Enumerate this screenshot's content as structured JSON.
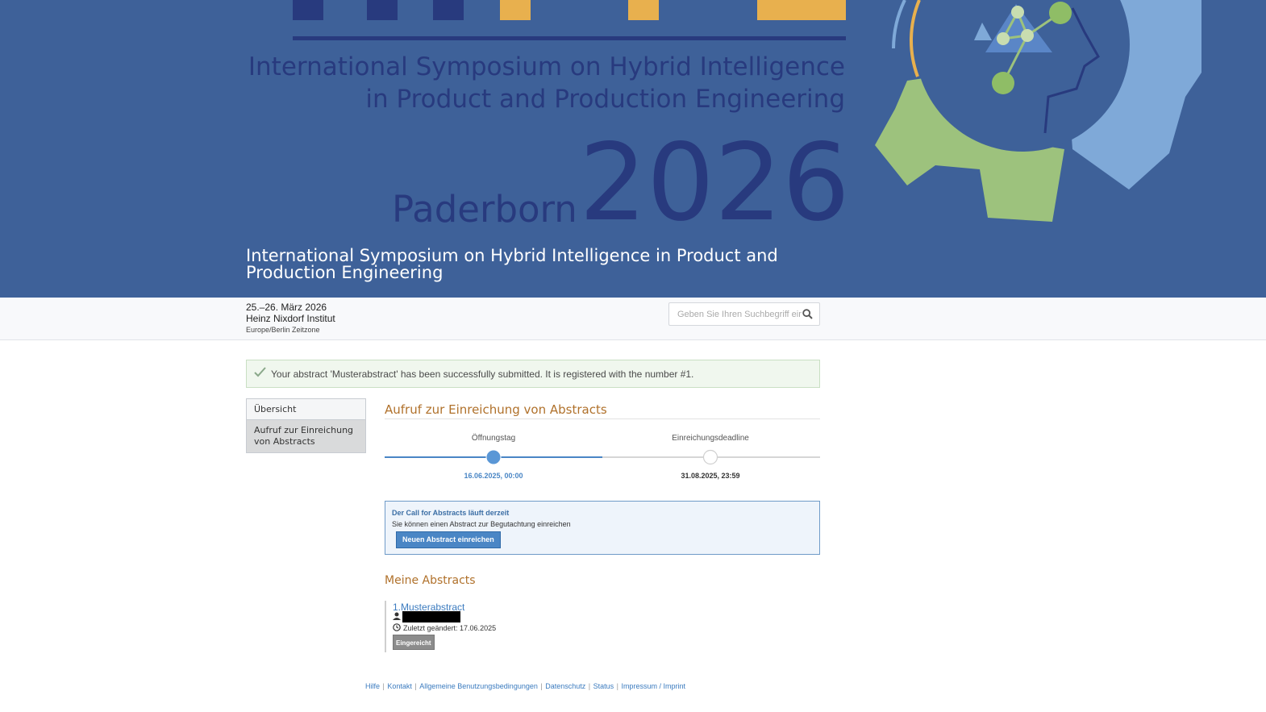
{
  "banner": {
    "logo_title_line1": "International Symposium on Hybrid Intelligence",
    "logo_title_line2": "in Product and Production Engineering",
    "logo_city": "Paderborn",
    "logo_year": "2026",
    "conference_title": "International Symposium on Hybrid Intelligence in Product and Production Engineering"
  },
  "info": {
    "date": "25.–26. März 2026",
    "venue": "Heinz Nixdorf Institut",
    "timezone": "Europe/Berlin Zeitzone"
  },
  "search": {
    "placeholder": "Geben Sie Ihren Suchbegriff ein"
  },
  "alert": {
    "message": "Your abstract 'Musterabstract' has been successfully submitted. It is registered with the number #1."
  },
  "sidebar": {
    "items": [
      {
        "label": "Übersicht",
        "active": false
      },
      {
        "label": "Aufruf zur Einreichung von Abstracts",
        "active": true
      }
    ]
  },
  "main": {
    "section_title": "Aufruf zur Einreichung von Abstracts",
    "timeline": {
      "start_label": "Öffnungstag",
      "start_date": "16.06.2025, 00:00",
      "end_label": "Einreichungsdeadline",
      "end_date": "31.08.2025, 23:59"
    },
    "cfa": {
      "title": "Der Call for Abstracts läuft derzeit",
      "text": "Sie können einen Abstract zur Begutachtung einreichen",
      "button_label": "Neuen Abstract einreichen"
    },
    "my_abstracts": {
      "title": "Meine Abstracts",
      "items": [
        {
          "number": "1.",
          "name": "Musterabstract",
          "modified": "Zuletzt geändert: 17.06.2025",
          "status": "Eingereicht"
        }
      ]
    }
  },
  "footer": {
    "links": [
      "Hilfe",
      "Kontakt",
      "Allgemeine Benutzungsbedingungen",
      "Datenschutz",
      "Status",
      "Impressum / Imprint"
    ]
  },
  "colors": {
    "banner_bg": "#3e6199",
    "accent_orange": "#b0712b",
    "link_blue": "#3b7bbf",
    "logo_green": "#9dc27d",
    "logo_yellow": "#e8b04e"
  }
}
